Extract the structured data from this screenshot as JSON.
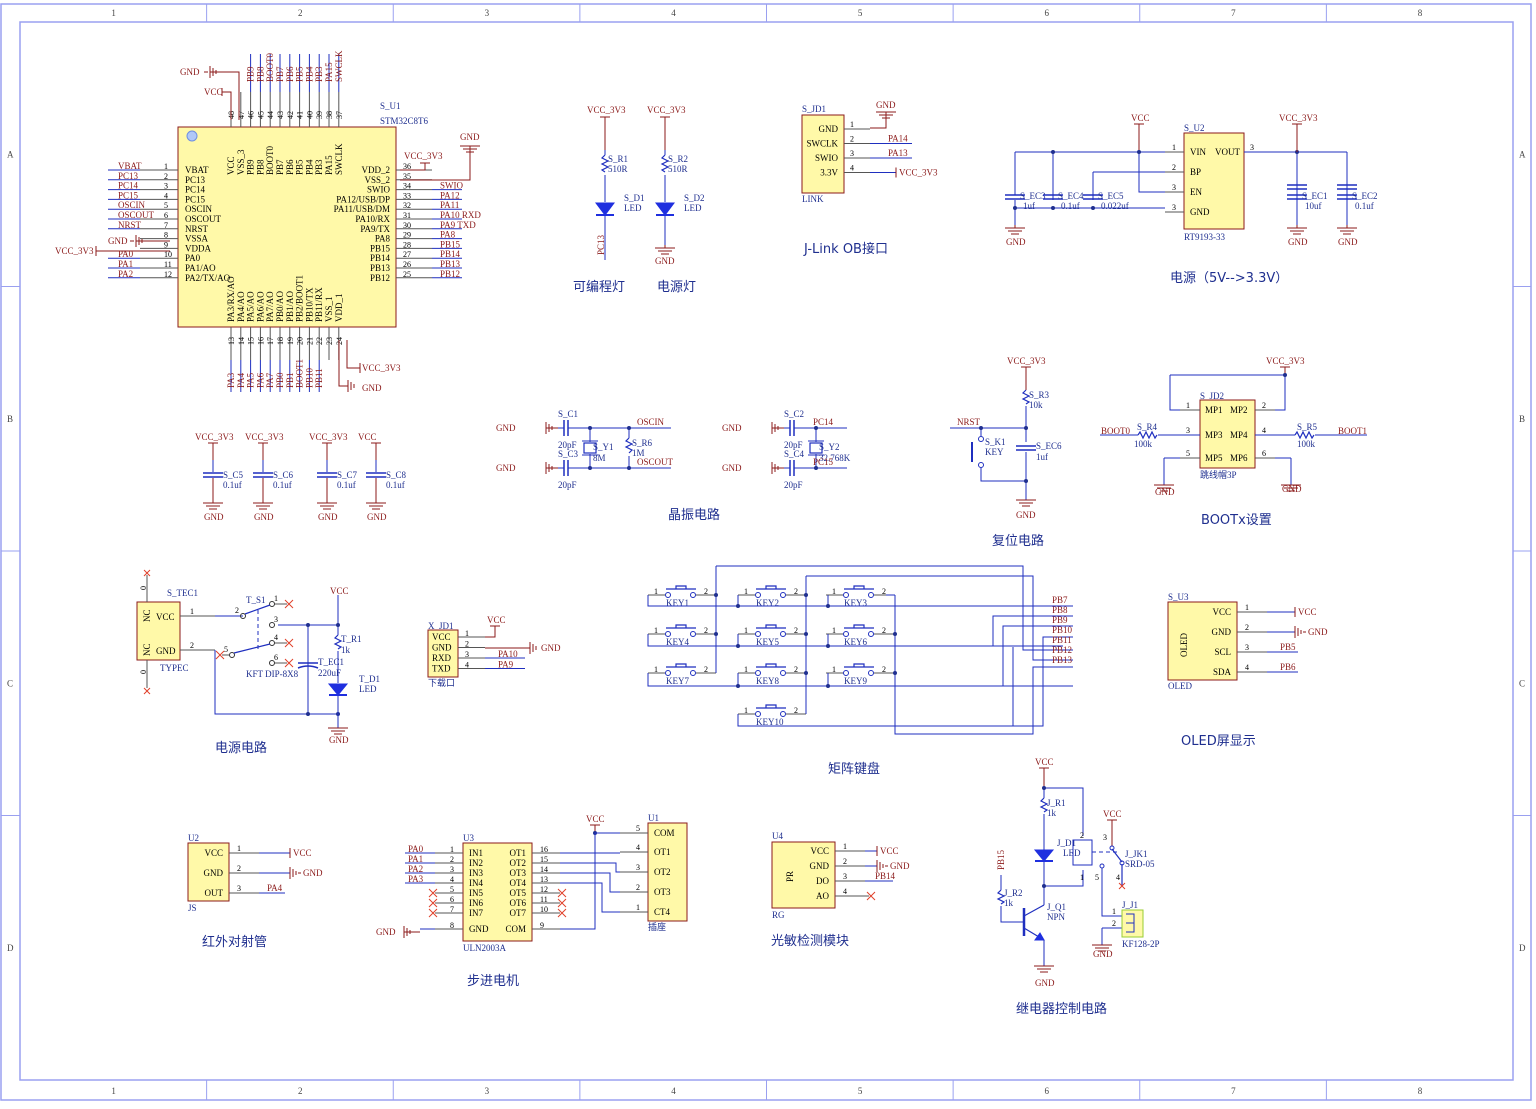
{
  "frame": {
    "columns": [
      "1",
      "2",
      "3",
      "4",
      "5",
      "6",
      "7",
      "8"
    ],
    "rows": [
      "A",
      "B",
      "C",
      "D"
    ]
  },
  "mcu": {
    "designator": "S_U1",
    "part": "STM32C8T6",
    "left_pins": [
      {
        "num": "1",
        "name": "VBAT",
        "net": "VBAT"
      },
      {
        "num": "2",
        "name": "PC13",
        "net": "PC13"
      },
      {
        "num": "3",
        "name": "PC14",
        "net": "PC14"
      },
      {
        "num": "4",
        "name": "PC15",
        "net": "PC15"
      },
      {
        "num": "5",
        "name": "OSCIN",
        "net": "OSCIN"
      },
      {
        "num": "6",
        "name": "OSCOUT",
        "net": "OSCOUT"
      },
      {
        "num": "7",
        "name": "NRST",
        "net": "NRST"
      },
      {
        "num": "8",
        "name": "VSSA",
        "net": "GND"
      },
      {
        "num": "9",
        "name": "VDDA",
        "net": "VCC_3V3"
      },
      {
        "num": "10",
        "name": "PA0",
        "net": "PA0"
      },
      {
        "num": "11",
        "name": "PA1/AO",
        "net": "PA1"
      },
      {
        "num": "12",
        "name": "PA2/TX/AO",
        "net": "PA2"
      }
    ],
    "right_pins": [
      {
        "num": "36",
        "name": "VDD_2",
        "net": "VCC_3V3"
      },
      {
        "num": "35",
        "name": "VSS_2",
        "net": "GND"
      },
      {
        "num": "34",
        "name": "SWIO",
        "net": "SWIO"
      },
      {
        "num": "33",
        "name": "PA12/USB/DP",
        "net": "PA12"
      },
      {
        "num": "32",
        "name": "PA11/USB/DM",
        "net": "PA11"
      },
      {
        "num": "31",
        "name": "PA10/RX",
        "net": "PA10  RXD"
      },
      {
        "num": "30",
        "name": "PA9/TX",
        "net": "PA9   TXD"
      },
      {
        "num": "29",
        "name": "PA8",
        "net": "PA8"
      },
      {
        "num": "28",
        "name": "PB15",
        "net": "PB15"
      },
      {
        "num": "27",
        "name": "PB14",
        "net": "PB14"
      },
      {
        "num": "26",
        "name": "PB13",
        "net": "PB13"
      },
      {
        "num": "25",
        "name": "PB12",
        "net": "PB12"
      }
    ],
    "top_pins": [
      {
        "num": "48",
        "name": "VCC",
        "net": "VCC"
      },
      {
        "num": "47",
        "name": "VSS_3",
        "net": "GND"
      },
      {
        "num": "46",
        "name": "PB9",
        "net": "PB9"
      },
      {
        "num": "45",
        "name": "PB8",
        "net": "PB8"
      },
      {
        "num": "44",
        "name": "BOOT0",
        "net": "BOOT0"
      },
      {
        "num": "43",
        "name": "PB7",
        "net": "PB7"
      },
      {
        "num": "42",
        "name": "PB6",
        "net": "PB6"
      },
      {
        "num": "41",
        "name": "PB5",
        "net": "PB5"
      },
      {
        "num": "40",
        "name": "PB4",
        "net": "PB4"
      },
      {
        "num": "39",
        "name": "PB3",
        "net": "PB3"
      },
      {
        "num": "38",
        "name": "PA15",
        "net": "PA15"
      },
      {
        "num": "37",
        "name": "SWCLK",
        "net": "SWCLK"
      }
    ],
    "bottom_pins": [
      {
        "num": "13",
        "name": "PA3/RX/AO",
        "net": "PA3"
      },
      {
        "num": "14",
        "name": "PA4/AO",
        "net": "PA4"
      },
      {
        "num": "15",
        "name": "PA5/AO",
        "net": "PA5"
      },
      {
        "num": "16",
        "name": "PA6/AO",
        "net": "PA6"
      },
      {
        "num": "17",
        "name": "PA7/AO",
        "net": "PA7"
      },
      {
        "num": "18",
        "name": "PB0/AO",
        "net": "PB0"
      },
      {
        "num": "19",
        "name": "PB1/AO",
        "net": "PB1"
      },
      {
        "num": "20",
        "name": "PB2/BOOT1",
        "net": "BOOT1"
      },
      {
        "num": "21",
        "name": "PB10/TX",
        "net": "PB10"
      },
      {
        "num": "22",
        "name": "PB11/RX",
        "net": "PB11"
      },
      {
        "num": "23",
        "name": "VSS_1",
        "net": "GND"
      },
      {
        "num": "24",
        "name": "VDD_1",
        "net": "VCC_3V3"
      }
    ],
    "power_labels": {
      "gnd": "GND",
      "vcc": "VCC",
      "vcc33": "VCC_3V3"
    }
  },
  "decoupling": [
    {
      "supply": "VCC_3V3",
      "des": "S_C5",
      "value": "0.1uf",
      "gnd": "GND"
    },
    {
      "supply": "VCC_3V3",
      "des": "S_C6",
      "value": "0.1uf",
      "gnd": "GND"
    },
    {
      "supply": "VCC_3V3",
      "des": "S_C7",
      "value": "0.1uf",
      "gnd": "GND"
    },
    {
      "supply": "VCC",
      "des": "S_C8",
      "value": "0.1uf",
      "gnd": "GND"
    }
  ],
  "leds": {
    "prog": {
      "supply": "VCC_3V3",
      "r_des": "S_R1",
      "r_val": "510R",
      "d_des": "S_D1",
      "d_val": "LED",
      "net": "PC13",
      "title": "可编程灯"
    },
    "power": {
      "supply": "VCC_3V3",
      "r_des": "S_R2",
      "r_val": "510R",
      "d_des": "S_D2",
      "d_val": "LED",
      "gnd": "GND",
      "title": "电源灯"
    }
  },
  "jlink": {
    "des": "S_JD1",
    "part": "LINK",
    "title": "J-Link OB接口",
    "gnd": "GND",
    "pins": [
      {
        "num": "1",
        "name": "GND",
        "net": ""
      },
      {
        "num": "2",
        "name": "SWCLK",
        "net": "PA14"
      },
      {
        "num": "3",
        "name": "SWIO",
        "net": "PA13"
      },
      {
        "num": "4",
        "name": "3.3V",
        "net": "VCC_3V3"
      }
    ]
  },
  "regulator": {
    "des": "S_U2",
    "part": "RT9193-33",
    "title": "电源（5V-->3.3V）",
    "vin": "VCC",
    "vout": "VCC_3V3",
    "pins": [
      {
        "num": "1",
        "name": "VIN"
      },
      {
        "num": "2",
        "name": "BP"
      },
      {
        "num": "3",
        "name": "EN"
      },
      {
        "num": "3",
        "name": "GND"
      }
    ],
    "out_pin": {
      "num": "3",
      "name": "VOUT"
    },
    "caps": [
      {
        "des": "S_EC3",
        "value": "1uf"
      },
      {
        "des": "S_EC4",
        "value": "0.1uf"
      },
      {
        "des": "S_EC5",
        "value": "0.022uf"
      },
      {
        "des": "S_EC1",
        "value": "10uf"
      },
      {
        "des": "S_EC2",
        "value": "0.1uf"
      }
    ],
    "gnd": "GND"
  },
  "crystal": {
    "title": "晶振电路",
    "gnd": "GND",
    "hse": {
      "c1": "S_C1",
      "c1v": "20pF",
      "c2": "S_C3",
      "c2v": "20pF",
      "y": "S_Y1",
      "yv": "8M",
      "r": "S_R6",
      "rv": "1M",
      "net1": "OSCIN",
      "net2": "OSCOUT"
    },
    "lse": {
      "c1": "S_C2",
      "c1v": "20pF",
      "c2": "S_C4",
      "c2v": "20pF",
      "y": "S_Y2",
      "yv": "32.768K",
      "net1": "PC14",
      "net2": "PC15"
    }
  },
  "reset": {
    "title": "复位电路",
    "supply": "VCC_3V3",
    "r_des": "S_R3",
    "r_val": "10k",
    "net": "NRST",
    "k_des": "S_K1",
    "k_val": "KEY",
    "c_des": "S_EC6",
    "c_val": "1uf",
    "gnd": "GND"
  },
  "boot": {
    "title": "BOOTx设置",
    "des": "S_JD2",
    "part": "跳线帽3P",
    "supply": "VCC_3V3",
    "pins": [
      {
        "l": "1",
        "ln": "MP1",
        "r": "2",
        "rn": "MP2"
      },
      {
        "l": "3",
        "ln": "MP3",
        "r": "4",
        "rn": "MP4"
      },
      {
        "l": "5",
        "ln": "MP5",
        "r": "6",
        "rn": "MP6"
      }
    ],
    "r4": {
      "des": "S_R4",
      "val": "100k",
      "net": "BOOT0"
    },
    "r5": {
      "des": "S_R5",
      "val": "100k",
      "net": "BOOT1"
    },
    "gnd": "GND"
  },
  "power_input": {
    "title": "电源电路",
    "conn_des": "S_TEC1",
    "conn_part": "TYPEC",
    "conn_pins": [
      {
        "num": "1",
        "name": "VCC"
      },
      {
        "num": "2",
        "name": "GND"
      }
    ],
    "nc": "NC",
    "zero": "0",
    "sw_des": "T_S1",
    "sw_part": "KFT DIP-8X8",
    "sw_pins": [
      "1",
      "2",
      "3",
      "4",
      "5",
      "6"
    ],
    "r_des": "T_R1",
    "r_val": "1k",
    "c_des": "T_EC1",
    "c_val": "220uF",
    "d_des": "T_D1",
    "d_val": "LED",
    "vcc": "VCC",
    "gnd": "GND"
  },
  "download": {
    "des": "X_JD1",
    "part": "下载口",
    "vcc": "VCC",
    "gnd": "GND",
    "pins": [
      {
        "num": "1",
        "name": "VCC",
        "net": ""
      },
      {
        "num": "2",
        "name": "GND",
        "net": ""
      },
      {
        "num": "3",
        "name": "RXD",
        "net": "PA10"
      },
      {
        "num": "4",
        "name": "TXD",
        "net": "PA9"
      }
    ]
  },
  "keypad": {
    "title": "矩阵键盘",
    "keys": [
      "KEY1",
      "KEY2",
      "KEY3",
      "KEY4",
      "KEY5",
      "KEY6",
      "KEY7",
      "KEY8",
      "KEY9",
      "KEY10"
    ],
    "pin_a": "1",
    "pin_b": "2",
    "nets": [
      "PB7",
      "PB8",
      "PB9",
      "PB10",
      "PB11",
      "PB12",
      "PB13"
    ]
  },
  "oled": {
    "title": "OLED屏显示",
    "des": "S_U3",
    "part": "OLED",
    "body": "OLED",
    "pins": [
      {
        "num": "1",
        "name": "VCC",
        "net": "VCC"
      },
      {
        "num": "2",
        "name": "GND",
        "net": "GND"
      },
      {
        "num": "3",
        "name": "SCL",
        "net": "PB5"
      },
      {
        "num": "4",
        "name": "SDA",
        "net": "PB6"
      }
    ]
  },
  "ir": {
    "title": "红外对射管",
    "des": "U2",
    "part": "JS",
    "pins": [
      {
        "num": "1",
        "name": "VCC",
        "net": "VCC"
      },
      {
        "num": "2",
        "name": "GND",
        "net": "GND"
      },
      {
        "num": "3",
        "name": "OUT",
        "net": "PA4"
      }
    ]
  },
  "stepper": {
    "title": "步进电机",
    "drv_des": "U3",
    "drv_part": "ULN2003A",
    "sock_des": "U1",
    "sock_part": "插座",
    "vcc": "VCC",
    "gnd": "GND",
    "in_pins": [
      {
        "num": "1",
        "name": "IN1",
        "net": "PA0"
      },
      {
        "num": "2",
        "name": "IN2",
        "net": "PA1"
      },
      {
        "num": "3",
        "name": "IN3",
        "net": "PA2"
      },
      {
        "num": "4",
        "name": "IN4",
        "net": "PA3"
      },
      {
        "num": "5",
        "name": "IN5",
        "net": ""
      },
      {
        "num": "6",
        "name": "IN6",
        "net": ""
      },
      {
        "num": "7",
        "name": "IN7",
        "net": ""
      },
      {
        "num": "8",
        "name": "GND",
        "net": "GND"
      }
    ],
    "out_pins": [
      {
        "num": "16",
        "name": "OT1"
      },
      {
        "num": "15",
        "name": "OT2"
      },
      {
        "num": "14",
        "name": "OT3"
      },
      {
        "num": "13",
        "name": "OT4"
      },
      {
        "num": "12",
        "name": "OT5"
      },
      {
        "num": "11",
        "name": "OT6"
      },
      {
        "num": "10",
        "name": "OT7"
      },
      {
        "num": "9",
        "name": "COM"
      }
    ],
    "sock_pins": [
      {
        "num": "5",
        "name": "COM"
      },
      {
        "num": "4",
        "name": "OT1"
      },
      {
        "num": "3",
        "name": "OT2"
      },
      {
        "num": "2",
        "name": "OT3"
      },
      {
        "num": "1",
        "name": "CT4"
      }
    ]
  },
  "light": {
    "title": "光敏检测模块",
    "des": "U4",
    "part": "RG",
    "body": "PR",
    "pins": [
      {
        "num": "1",
        "name": "VCC",
        "net": "VCC"
      },
      {
        "num": "2",
        "name": "GND",
        "net": "GND"
      },
      {
        "num": "3",
        "name": "DO",
        "net": "PB14"
      },
      {
        "num": "4",
        "name": "AO",
        "net": ""
      }
    ]
  },
  "relay": {
    "title": "继电器控制电路",
    "vcc": "VCC",
    "gnd": "GND",
    "r1_des": "J_R1",
    "r1_val": "1k",
    "d_des": "J_D1",
    "d_val": "LED",
    "r2_des": "J_R2",
    "r2_val": "1k",
    "net": "PB15",
    "q_des": "J_Q1",
    "q_val": "NPN",
    "k_des": "J_JK1",
    "k_val": "SRD-05",
    "k_pins": [
      "1",
      "2",
      "3",
      "4",
      "5"
    ],
    "j_des": "J_J1",
    "j_val": "KF128-2P",
    "j_pins": [
      "1",
      "2"
    ]
  }
}
